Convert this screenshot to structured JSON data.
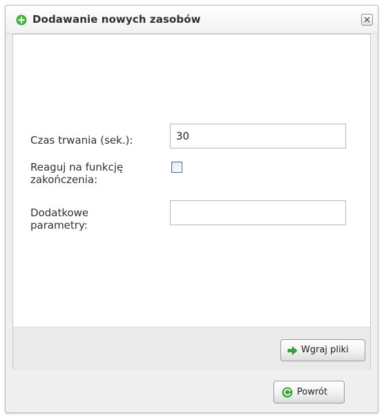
{
  "dialog": {
    "title": "Dodawanie nowych zasobów",
    "title_icon": "add-icon",
    "close_icon": "close-icon"
  },
  "form": {
    "duration": {
      "label": "Czas trwania (sek.):",
      "value": "30"
    },
    "react_end": {
      "label_line1": "Reaguj na funkcję",
      "label_line2": "zakończenia:",
      "checked": false
    },
    "extra_params": {
      "label_line1": "Dodatkowe",
      "label_line2": "parametry:",
      "value": ""
    }
  },
  "buttons": {
    "upload": {
      "label": "Wgraj pliki",
      "icon": "arrow-right-icon"
    },
    "back": {
      "label": "Powrót",
      "icon": "refresh-icon"
    }
  },
  "colors": {
    "accent_green": "#3aa635",
    "checkbox_border": "#46648c"
  }
}
